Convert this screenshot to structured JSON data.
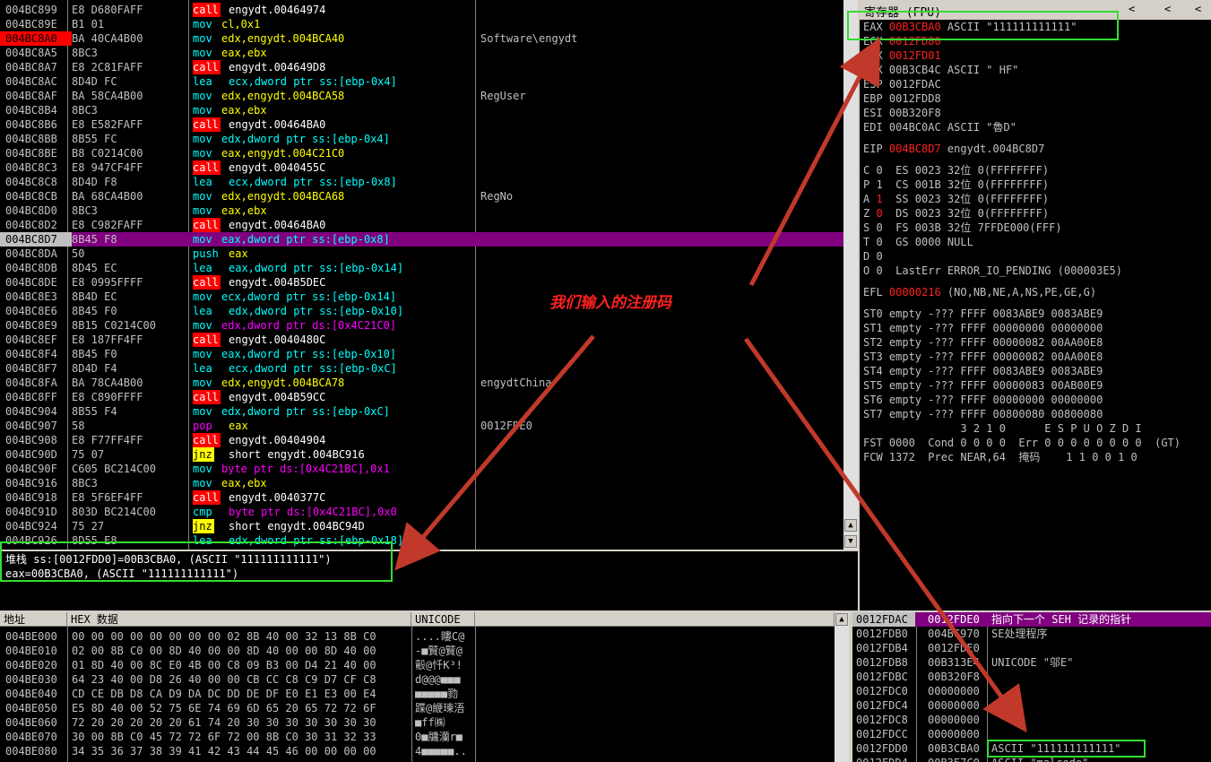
{
  "disasm": {
    "rows": [
      {
        "addr": "004BC899",
        "hex": "E8 D680FAFF",
        "kw": "call",
        "kwtype": "call",
        "ops": "engydt.00464974",
        "comment": ""
      },
      {
        "addr": "004BC89E",
        "hex": "B1 01",
        "kw": "mov",
        "kwtype": "mov",
        "ops": "cl,0x1",
        "comment": ""
      },
      {
        "addr": "004BC8A0",
        "hex": "BA 40CA4B00",
        "kw": "mov",
        "kwtype": "mov",
        "ops": "edx,engydt.004BCA40",
        "comment": "Software\\engydt"
      },
      {
        "addr": "004BC8A5",
        "hex": "8BC3",
        "kw": "mov",
        "kwtype": "mov",
        "ops": "eax,ebx",
        "comment": ""
      },
      {
        "addr": "004BC8A7",
        "hex": "E8 2C81FAFF",
        "kw": "call",
        "kwtype": "call",
        "ops": "engydt.004649D8",
        "comment": ""
      },
      {
        "addr": "004BC8AC",
        "hex": "8D4D FC",
        "kw": "lea",
        "kwtype": "lea",
        "ops": "ecx,dword ptr ss:[ebp-0x4]",
        "comment": ""
      },
      {
        "addr": "004BC8AF",
        "hex": "BA 58CA4B00",
        "kw": "mov",
        "kwtype": "mov",
        "ops": "edx,engydt.004BCA58",
        "comment": "RegUser"
      },
      {
        "addr": "004BC8B4",
        "hex": "8BC3",
        "kw": "mov",
        "kwtype": "mov",
        "ops": "eax,ebx",
        "comment": ""
      },
      {
        "addr": "004BC8B6",
        "hex": "E8 E582FAFF",
        "kw": "call",
        "kwtype": "call",
        "ops": "engydt.00464BA0",
        "comment": ""
      },
      {
        "addr": "004BC8BB",
        "hex": "8B55 FC",
        "kw": "mov",
        "kwtype": "mov",
        "ops": "edx,dword ptr ss:[ebp-0x4]",
        "comment": ""
      },
      {
        "addr": "004BC8BE",
        "hex": "B8 C0214C00",
        "kw": "mov",
        "kwtype": "mov",
        "ops": "eax,engydt.004C21C0",
        "comment": ""
      },
      {
        "addr": "004BC8C3",
        "hex": "E8 947CF4FF",
        "kw": "call",
        "kwtype": "call",
        "ops": "engydt.0040455C",
        "comment": ""
      },
      {
        "addr": "004BC8C8",
        "hex": "8D4D F8",
        "kw": "lea",
        "kwtype": "lea",
        "ops": "ecx,dword ptr ss:[ebp-0x8]",
        "comment": ""
      },
      {
        "addr": "004BC8CB",
        "hex": "BA 68CA4B00",
        "kw": "mov",
        "kwtype": "mov",
        "ops": "edx,engydt.004BCA68",
        "comment": "RegNo"
      },
      {
        "addr": "004BC8D0",
        "hex": "8BC3",
        "kw": "mov",
        "kwtype": "mov",
        "ops": "eax,ebx",
        "comment": ""
      },
      {
        "addr": "004BC8D2",
        "hex": "E8 C982FAFF",
        "kw": "call",
        "kwtype": "call",
        "ops": "engydt.00464BA0",
        "comment": ""
      },
      {
        "addr": "004BC8D7",
        "hex": "8B45 F8",
        "kw": "mov",
        "kwtype": "mov",
        "ops": "eax,dword ptr ss:[ebp-0x8]",
        "comment": ""
      },
      {
        "addr": "004BC8DA",
        "hex": "50",
        "kw": "push",
        "kwtype": "push",
        "ops": "eax",
        "comment": ""
      },
      {
        "addr": "004BC8DB",
        "hex": "8D45 EC",
        "kw": "lea",
        "kwtype": "lea",
        "ops": "eax,dword ptr ss:[ebp-0x14]",
        "comment": ""
      },
      {
        "addr": "004BC8DE",
        "hex": "E8 0995FFFF",
        "kw": "call",
        "kwtype": "call",
        "ops": "engydt.004B5DEC",
        "comment": ""
      },
      {
        "addr": "004BC8E3",
        "hex": "8B4D EC",
        "kw": "mov",
        "kwtype": "mov",
        "ops": "ecx,dword ptr ss:[ebp-0x14]",
        "comment": ""
      },
      {
        "addr": "004BC8E6",
        "hex": "8B45 F0",
        "kw": "lea",
        "kwtype": "lea",
        "ops": "edx,dword ptr ss:[ebp-0x10]",
        "comment": ""
      },
      {
        "addr": "004BC8E9",
        "hex": "8B15 C0214C00",
        "kw": "mov",
        "kwtype": "mov",
        "ops": "edx,dword ptr ds:[0x4C21C0]",
        "comment": ""
      },
      {
        "addr": "004BC8EF",
        "hex": "E8 187FF4FF",
        "kw": "call",
        "kwtype": "call",
        "ops": "engydt.0040480C",
        "comment": ""
      },
      {
        "addr": "004BC8F4",
        "hex": "8B45 F0",
        "kw": "mov",
        "kwtype": "mov",
        "ops": "eax,dword ptr ss:[ebp-0x10]",
        "comment": ""
      },
      {
        "addr": "004BC8F7",
        "hex": "8D4D F4",
        "kw": "lea",
        "kwtype": "lea",
        "ops": "ecx,dword ptr ss:[ebp-0xC]",
        "comment": ""
      },
      {
        "addr": "004BC8FA",
        "hex": "BA 78CA4B00",
        "kw": "mov",
        "kwtype": "mov",
        "ops": "edx,engydt.004BCA78",
        "comment": "engydtChina"
      },
      {
        "addr": "004BC8FF",
        "hex": "E8 C890FFFF",
        "kw": "call",
        "kwtype": "call",
        "ops": "engydt.004B59CC",
        "comment": ""
      },
      {
        "addr": "004BC904",
        "hex": "8B55 F4",
        "kw": "mov",
        "kwtype": "mov",
        "ops": "edx,dword ptr ss:[ebp-0xC]",
        "comment": ""
      },
      {
        "addr": "004BC907",
        "hex": "58",
        "kw": "pop",
        "kwtype": "push",
        "ops": "eax",
        "comment": "0012FDE0"
      },
      {
        "addr": "004BC908",
        "hex": "E8 F77FF4FF",
        "kw": "call",
        "kwtype": "call",
        "ops": "engydt.00404904",
        "comment": ""
      },
      {
        "addr": "004BC90D",
        "hex": "75 07",
        "kw": "jnz",
        "kwtype": "jnz",
        "ops": "short engydt.004BC916",
        "comment": ""
      },
      {
        "addr": "004BC90F",
        "hex": "C605 BC214C00",
        "kw": "mov",
        "kwtype": "mov",
        "ops": "byte ptr ds:[0x4C21BC],0x1",
        "comment": ""
      },
      {
        "addr": "004BC916",
        "hex": "8BC3",
        "kw": "mov",
        "kwtype": "mov",
        "ops": "eax,ebx",
        "comment": ""
      },
      {
        "addr": "004BC918",
        "hex": "E8 5F6EF4FF",
        "kw": "call",
        "kwtype": "call",
        "ops": "engydt.0040377C",
        "comment": ""
      },
      {
        "addr": "004BC91D",
        "hex": "803D BC214C00",
        "kw": "cmp",
        "kwtype": "mov",
        "ops": "byte ptr ds:[0x4C21BC],0x0",
        "comment": ""
      },
      {
        "addr": "004BC924",
        "hex": "75 27",
        "kw": "jnz",
        "kwtype": "jnz",
        "ops": "short engydt.004BC94D",
        "comment": ""
      },
      {
        "addr": "004BC926",
        "hex": "8D55 E8",
        "kw": "lea",
        "kwtype": "lea",
        "ops": "edx,dword ptr ss:[ebp-0x18]",
        "comment": ""
      }
    ]
  },
  "info": {
    "line1": "堆栈 ss:[0012FDD0]=00B3CBA0, (ASCII \"111111111111\")",
    "line2": "eax=00B3CBA0, (ASCII \"111111111111\")"
  },
  "registers": {
    "title": "寄存器 (FPU)",
    "nav": [
      "<",
      "<",
      "<"
    ],
    "lines": [
      {
        "t": "EAX ",
        "v": "00B3CBA0",
        "vc": "red",
        "r": " ASCII \"111111111111\""
      },
      {
        "t": "ECX ",
        "v": "0012FD80",
        "vc": "red",
        "r": ""
      },
      {
        "t": "EDX ",
        "v": "0012FD01",
        "vc": "red",
        "r": ""
      },
      {
        "t": "EBX ",
        "v": "00B3CB4C",
        "vc": "w",
        "r": " ASCII \" HF\""
      },
      {
        "t": "ESP ",
        "v": "0012FDAC",
        "vc": "w",
        "r": ""
      },
      {
        "t": "EBP ",
        "v": "0012FDD8",
        "vc": "w",
        "r": ""
      },
      {
        "t": "ESI ",
        "v": "00B320F8",
        "vc": "w",
        "r": ""
      },
      {
        "t": "EDI ",
        "v": "004BC0AC",
        "vc": "w",
        "r": " ASCII \"魯D\""
      },
      {
        "t": "",
        "v": "",
        "vc": "w",
        "r": ""
      },
      {
        "t": "EIP ",
        "v": "004BC8D7",
        "vc": "red",
        "r": " engydt.004BC8D7"
      },
      {
        "t": "",
        "v": "",
        "vc": "w",
        "r": ""
      },
      {
        "t": "C 0  ",
        "v": "",
        "vc": "w",
        "r": "ES 0023 32位 0(FFFFFFFF)"
      },
      {
        "t": "P 1  ",
        "v": "",
        "vc": "w",
        "r": "CS 001B 32位 0(FFFFFFFF)"
      },
      {
        "t": "A ",
        "v": "1",
        "vc": "red",
        "r": "  SS 0023 32位 0(FFFFFFFF)"
      },
      {
        "t": "Z ",
        "v": "0",
        "vc": "red",
        "r": "  DS 0023 32位 0(FFFFFFFF)"
      },
      {
        "t": "S 0  ",
        "v": "",
        "vc": "w",
        "r": "FS 003B 32位 7FFDE000(FFF)"
      },
      {
        "t": "T 0  ",
        "v": "",
        "vc": "w",
        "r": "GS 0000 NULL"
      },
      {
        "t": "D 0",
        "v": "",
        "vc": "w",
        "r": ""
      },
      {
        "t": "O 0  ",
        "v": "",
        "vc": "w",
        "r": "LastErr ERROR_IO_PENDING (000003E5)"
      },
      {
        "t": "",
        "v": "",
        "vc": "w",
        "r": ""
      },
      {
        "t": "EFL ",
        "v": "00000216",
        "vc": "red",
        "r": " (NO,NB,NE,A,NS,PE,GE,G)"
      },
      {
        "t": "",
        "v": "",
        "vc": "w",
        "r": ""
      },
      {
        "t": "ST0 ",
        "v": "",
        "vc": "w",
        "r": "empty -??? FFFF 0083ABE9 0083ABE9"
      },
      {
        "t": "ST1 ",
        "v": "",
        "vc": "w",
        "r": "empty -??? FFFF 00000000 00000000"
      },
      {
        "t": "ST2 ",
        "v": "",
        "vc": "w",
        "r": "empty -??? FFFF 00000082 00AA00E8"
      },
      {
        "t": "ST3 ",
        "v": "",
        "vc": "w",
        "r": "empty -??? FFFF 00000082 00AA00E8"
      },
      {
        "t": "ST4 ",
        "v": "",
        "vc": "w",
        "r": "empty -??? FFFF 0083ABE9 0083ABE9"
      },
      {
        "t": "ST5 ",
        "v": "",
        "vc": "w",
        "r": "empty -??? FFFF 00000083 00AB00E9"
      },
      {
        "t": "ST6 ",
        "v": "",
        "vc": "w",
        "r": "empty -??? FFFF 00000000 00000000"
      },
      {
        "t": "ST7 ",
        "v": "",
        "vc": "w",
        "r": "empty -??? FFFF 00800080 00800080"
      },
      {
        "t": "               3 2 1 0      E S P U O Z D I",
        "v": "",
        "vc": "w",
        "r": ""
      },
      {
        "t": "FST 0000  Cond 0 0 0 0  Err 0 0 0 0 0 0 0 0  (GT)",
        "v": "",
        "vc": "w",
        "r": ""
      },
      {
        "t": "FCW 1372  Prec NEAR,64  掩码    1 1 0 0 1 0",
        "v": "",
        "vc": "w",
        "r": ""
      }
    ]
  },
  "dump": {
    "col_addr": "地址",
    "col_hex": "HEX 数据",
    "col_uni": "UNICODE",
    "rows": [
      {
        "addr": "004BE000",
        "hex": "00 00 00 00 00 00 00 00 02 8B 40 00 32 13 8B C0",
        "uni": "....瞜C@"
      },
      {
        "addr": "004BE010",
        "hex": "02 00 8B C0 00 8D 40 00 00 8D 40 00 00 8D 40 00",
        "uni": "-■贒@贒@"
      },
      {
        "addr": "004BE020",
        "hex": "01 8D 40 00 8C E0 4B 00 C8 09 B3 00 D4 21 40 00",
        "uni": "鷇@忏K³!"
      },
      {
        "addr": "004BE030",
        "hex": "64 23 40 00 D8 26 40 00 00 CB CC C8 C9 D7 CF C8",
        "uni": "d@@@■■■"
      },
      {
        "addr": "004BE040",
        "hex": "CD CE DB D8 CA D9 DA DC DD DE DF E0 E1 E3 00 E4",
        "uni": "■■■■■勠"
      },
      {
        "addr": "004BE050",
        "hex": "E5 8D 40 00 52 75 6E 74 69 6D 65 20 65 72 72 6F",
        "uni": "蹀@緶瑓浯"
      },
      {
        "addr": "004BE060",
        "hex": "72 20 20 20 20 20 61 74 20 30 30 30 30 30 30 30",
        "uni": "■ff㈱"
      },
      {
        "addr": "004BE070",
        "hex": "30 00 8B C0 45 72 72 6F 72 00 8B C0 30 31 32 33",
        "uni": "0■牗灡r■"
      },
      {
        "addr": "004BE080",
        "hex": "34 35 36 37 38 39 41 42 43 44 45 46 00 00 00 00",
        "uni": "4■■■■■.."
      }
    ]
  },
  "stack": {
    "rows": [
      {
        "addr": "0012FDAC",
        "val": "0012FDE0",
        "comment": "指向下一个 SEH 记录的指针",
        "hl": true
      },
      {
        "addr": "0012FDB0",
        "val": "004BC970",
        "comment": "SE处理程序",
        "hl": false
      },
      {
        "addr": "0012FDB4",
        "val": "0012FDE0",
        "comment": "",
        "hl": false
      },
      {
        "addr": "0012FDB8",
        "val": "00B313E4",
        "comment": "UNICODE \"邬E\"",
        "hl": false
      },
      {
        "addr": "0012FDBC",
        "val": "00B320F8",
        "comment": "",
        "hl": false
      },
      {
        "addr": "0012FDC0",
        "val": "00000000",
        "comment": "",
        "hl": false
      },
      {
        "addr": "0012FDC4",
        "val": "00000000",
        "comment": "",
        "hl": false
      },
      {
        "addr": "0012FDC8",
        "val": "00000000",
        "comment": "",
        "hl": false
      },
      {
        "addr": "0012FDCC",
        "val": "00000000",
        "comment": "",
        "hl": false
      },
      {
        "addr": "0012FDD0",
        "val": "00B3CBA0",
        "comment": "ASCII \"111111111111\"",
        "hl": false
      },
      {
        "addr": "0012FDD4",
        "val": "00B3E7C0",
        "comment": "ASCII \"malcode\"",
        "hl": false
      }
    ]
  },
  "annotation": {
    "text": "我们输入的注册码",
    "color": "#ff2020",
    "arrow_color": "#c0392b",
    "box_color": "#33dd33"
  },
  "colors": {
    "background": "#000000",
    "selected_row": "#800080",
    "eip_addr_bg": "#ff0000",
    "call_bg": "#ff0000",
    "jnz_bg": "#ffff00"
  }
}
